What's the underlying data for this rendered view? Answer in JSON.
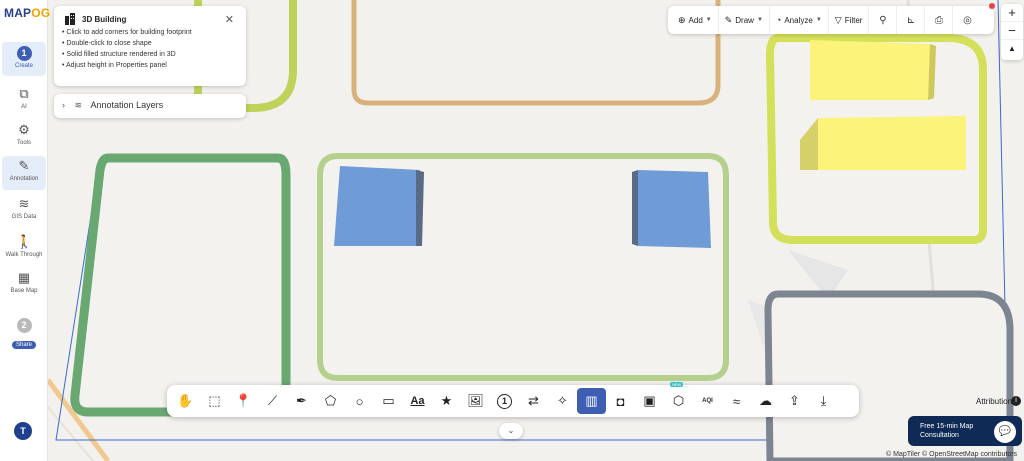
{
  "brand": {
    "name_main": "MAP",
    "name_accent": "OG"
  },
  "sidebar": {
    "create": {
      "step": "1",
      "label": "Create"
    },
    "items": [
      {
        "label": "AI",
        "icon": "ai-icon"
      },
      {
        "label": "Tools",
        "icon": "tools-icon"
      },
      {
        "label": "Annotation",
        "icon": "annotation-icon"
      },
      {
        "label": "GIS Data",
        "icon": "layers-icon"
      },
      {
        "label": "Walk Through",
        "icon": "walk-icon"
      },
      {
        "label": "Base Map",
        "icon": "basemap-icon"
      }
    ],
    "share": {
      "step": "2",
      "label": "Share"
    },
    "avatar": "T"
  },
  "info_panel": {
    "title": "3D Building",
    "tips": [
      "• Click to add corners for building footprint",
      "• Double-click to close shape",
      "• Solid filled structure rendered in 3D",
      "• Adjust height in Properties panel"
    ]
  },
  "annotation_layers": {
    "label": "Annotation Layers"
  },
  "top_toolbar": {
    "add": "Add",
    "draw": "Draw",
    "analyze": "Analyze",
    "filter": "Filter"
  },
  "zoom": {
    "in": "+",
    "out": "−"
  },
  "bottom_toolbar": {
    "new_badge": "NEW",
    "numbered_marker": "1",
    "aqi": "AQI",
    "text_tool": "Aa"
  },
  "consult": {
    "line1": "Free 15-min Map",
    "line2": "Consultation"
  },
  "attribution": "Attribution",
  "copyright": "© MapTiler © OpenStreetMap contributors",
  "colors": {
    "accent": "#3d5eb3",
    "building_blue": "#6f9bd6",
    "building_yellow": "#fbf37a",
    "wall_green": "#6aa872",
    "wall_yellow": "#d5e05a",
    "wall_tan": "#d8b27c",
    "wall_grey": "#7d8590"
  }
}
